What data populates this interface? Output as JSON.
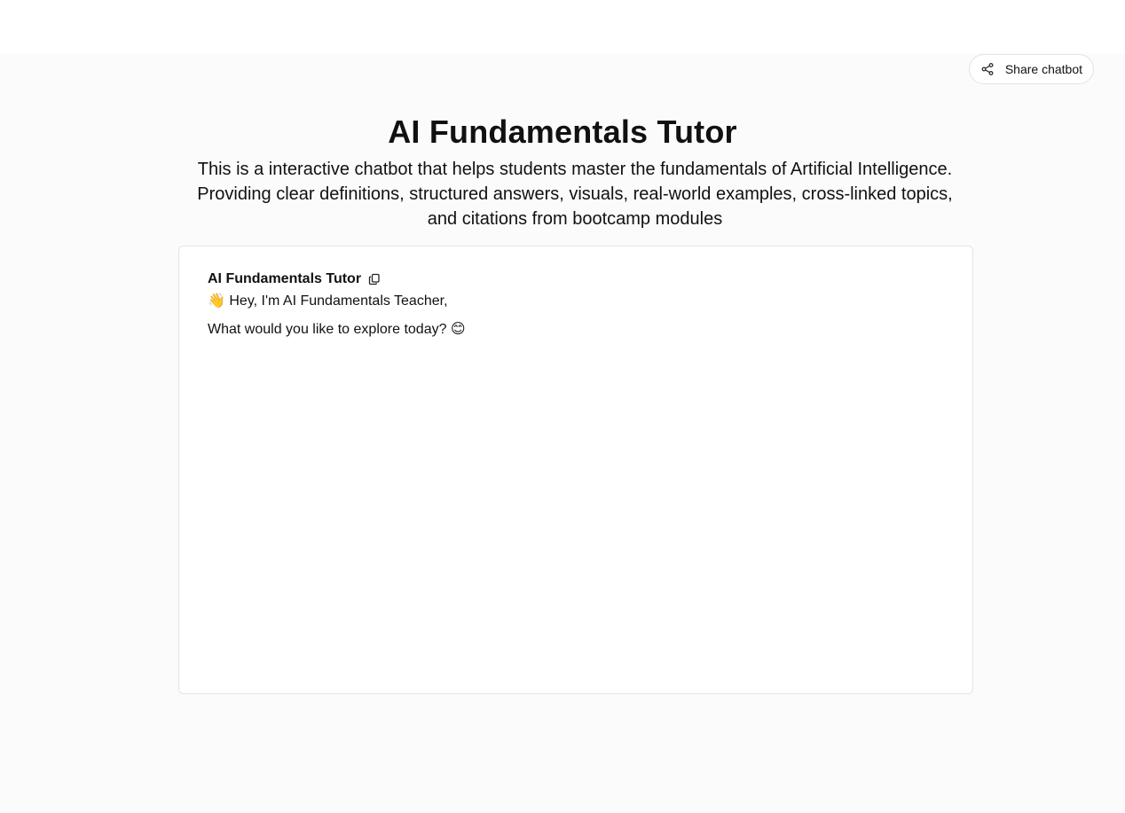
{
  "header": {
    "share_label": "Share chatbot"
  },
  "hero": {
    "title": "AI Fundamentals Tutor",
    "description": "This is a interactive chatbot that helps students master the fundamentals of Artificial Intelligence. Providing clear definitions, structured answers, visuals, real-world examples, cross-linked topics, and citations from bootcamp modules"
  },
  "chat": {
    "messages": [
      {
        "sender": "AI Fundamentals Tutor",
        "lines": [
          "👋 Hey, I'm AI Fundamentals Teacher,",
          "What would you like to explore today? 😊"
        ]
      }
    ]
  },
  "icons": {
    "share": "share-icon",
    "copy": "copy-icon"
  }
}
